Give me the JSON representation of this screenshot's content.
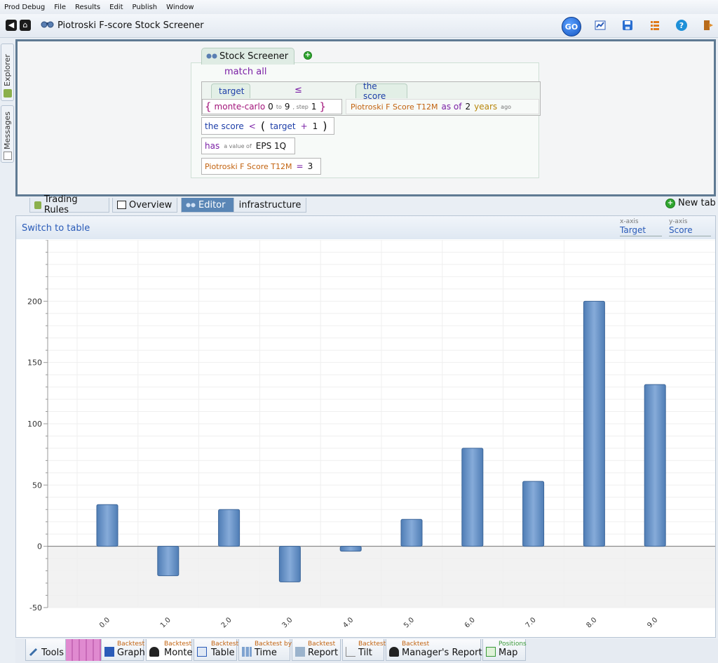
{
  "menu": [
    "Prod Debug",
    "File",
    "Results",
    "Edit",
    "Publish",
    "Window"
  ],
  "app": {
    "title": "Piotroski F-score Stock Screener",
    "go_label": "GO"
  },
  "sidebar": {
    "explorer_label": "Explorer",
    "messages_label": "Messages"
  },
  "editor": {
    "tab_label": "Stock Screener",
    "match_label": "match all",
    "rule1": {
      "header_left": "target",
      "operator": "≤",
      "header_right": "the score",
      "open_brace": "{",
      "func": "monte-carlo",
      "from": "0",
      "to_word": "to",
      "to": "9",
      "step_word": ", step",
      "step": "1",
      "close_brace": "}",
      "metric": "Piotroski F Score T12M",
      "as_of": "as of",
      "n": "2",
      "unit": "years",
      "ago": "ago"
    },
    "rule2": {
      "a": "the score",
      "op": "<",
      "lp": "(",
      "b": "target",
      "plus": "+",
      "c": "1",
      "rp": ")"
    },
    "rule3": {
      "a": "has",
      "b": "a value of",
      "c": "EPS 1Q"
    },
    "rule4": {
      "a": "Piotroski F Score T12M",
      "op": "=",
      "b": "3"
    }
  },
  "tabs": [
    {
      "label": "Trading Rules"
    },
    {
      "label": "Overview"
    },
    {
      "label": "Editor"
    },
    {
      "label": "infrastructure"
    }
  ],
  "new_tab_label": "New tab",
  "chart_header": {
    "switch_label": "Switch to table",
    "x_axis_caption": "x-axis",
    "x_axis_value": "Target",
    "y_axis_caption": "y-axis",
    "y_axis_value": "Score"
  },
  "chart_data": {
    "type": "bar",
    "categories": [
      "0.0",
      "1.0",
      "2.0",
      "3.0",
      "4.0",
      "5.0",
      "6.0",
      "7.0",
      "8.0",
      "9.0"
    ],
    "values": [
      34,
      -24,
      30,
      -29,
      -4,
      22,
      80,
      53,
      200,
      132
    ],
    "ylim": [
      -50,
      250
    ],
    "yticks": [
      -50,
      0,
      50,
      100,
      150,
      200
    ],
    "bar_color": "#6f9bd1",
    "grid": true
  },
  "bottom_tabs": [
    {
      "small": "",
      "main": "Tools"
    },
    {
      "small": "Backtest",
      "main": "Graph"
    },
    {
      "small": "Backtest",
      "main": "Monte"
    },
    {
      "small": "Backtest",
      "main": "Table"
    },
    {
      "small": "Backtest by",
      "main": "Time"
    },
    {
      "small": "Backtest",
      "main": "Report"
    },
    {
      "small": "Backtest",
      "main": "Tilt"
    },
    {
      "small": "Backtest",
      "main": "Manager's Report"
    },
    {
      "small": "Positions",
      "main": "Map"
    }
  ]
}
